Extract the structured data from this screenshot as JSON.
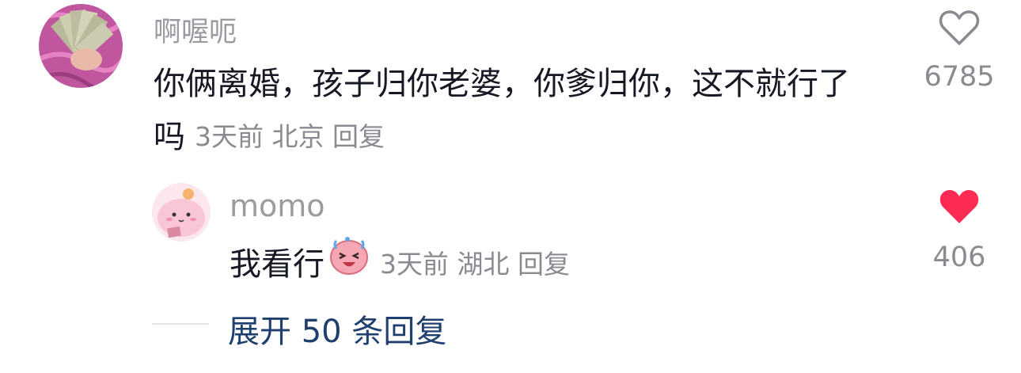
{
  "comments": [
    {
      "username": "啊喔呃",
      "text_line1": "你俩离婚，孩子归你老婆，你爹归你，这不就行了",
      "text_line2": "吗",
      "time": "3天前",
      "location": "北京",
      "reply_label": "回复",
      "likes": "6785",
      "liked": false,
      "avatar_icon": "money-fan-avatar"
    },
    {
      "username": "momo",
      "text": "我看行",
      "emoji_icon": "laughing-tears-emoji",
      "time": "3天前",
      "location": "湖北",
      "reply_label": "回复",
      "likes": "406",
      "liked": true,
      "avatar_icon": "pink-blob-avatar"
    }
  ],
  "expand_replies": "展开 50 条回复",
  "colors": {
    "text_primary": "#161823",
    "text_secondary": "#8a8b91",
    "like_active": "#fe2c55",
    "link": "#1f3f6e"
  }
}
